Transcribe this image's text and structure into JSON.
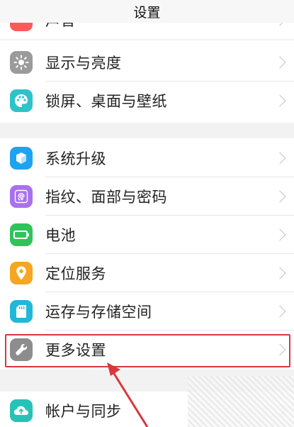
{
  "header": {
    "title": "设置"
  },
  "top_partial": {
    "label": "声音"
  },
  "group1": [
    {
      "label": "显示与亮度",
      "icon": "sun-icon",
      "color": "#9b9b9b"
    },
    {
      "label": "锁屏、桌面与壁纸",
      "icon": "palette-icon",
      "color": "#2fc3c8"
    }
  ],
  "group2": [
    {
      "label": "系统升级",
      "icon": "upgrade-box-icon",
      "color": "#1fa3f0"
    },
    {
      "label": "指纹、面部与密码",
      "icon": "fingerprint-icon",
      "color": "#a970f0"
    },
    {
      "label": "电池",
      "icon": "battery-icon",
      "color": "#2fc45a"
    },
    {
      "label": "定位服务",
      "icon": "location-pin-icon",
      "color": "#f5a623"
    },
    {
      "label": "运存与存储空间",
      "icon": "sd-card-icon",
      "color": "#21b8d8"
    },
    {
      "label": "更多设置",
      "icon": "wrench-icon",
      "color": "#8d8d8d"
    }
  ],
  "group3": [
    {
      "label": "帐户与同步",
      "icon": "cloud-sync-icon",
      "color": "#26c2b8"
    }
  ],
  "annotation": {
    "highlight_color": "#d9363e"
  }
}
